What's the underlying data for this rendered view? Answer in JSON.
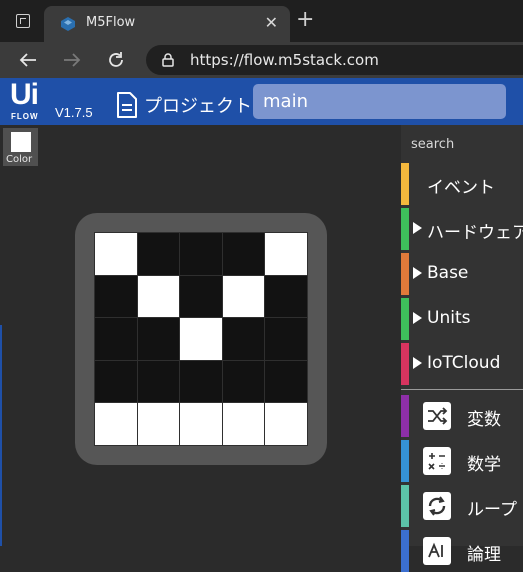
{
  "browser": {
    "tab_title": "M5Flow",
    "tab_close": "✕",
    "new_tab": "+",
    "url": "https://flow.m5stack.com"
  },
  "header": {
    "logo_top": "Ui",
    "logo_bottom": "FLOW",
    "version": "V1.7.5",
    "project_label": "プロジェクト",
    "project_name": "main"
  },
  "workspace": {
    "color_label": "Color",
    "matrix": [
      [
        1,
        0,
        0,
        0,
        1
      ],
      [
        0,
        1,
        0,
        1,
        0
      ],
      [
        0,
        0,
        1,
        0,
        0
      ],
      [
        0,
        0,
        0,
        0,
        0
      ],
      [
        1,
        1,
        1,
        1,
        1
      ]
    ],
    "on_color": "#ffffff",
    "off_color": "#121212"
  },
  "sidebar": {
    "search_placeholder": "search",
    "categories": [
      {
        "label": "イベント",
        "color": "#f4b83d",
        "arrow": false
      },
      {
        "label": "ハードウェア",
        "color": "#3ebf5b",
        "arrow": true
      },
      {
        "label": "Base",
        "color": "#e07a3a",
        "arrow": true
      },
      {
        "label": "Units",
        "color": "#3ebf5b",
        "arrow": true
      },
      {
        "label": "IoTCloud",
        "color": "#d8345f",
        "arrow": true
      }
    ],
    "tools": [
      {
        "label": "変数",
        "color": "#8e2fa8",
        "icon": "shuffle-icon"
      },
      {
        "label": "数学",
        "color": "#3592d6",
        "icon": "math-operators-icon"
      },
      {
        "label": "ループ",
        "color": "#5cc3a8",
        "icon": "loop-icon"
      },
      {
        "label": "論理",
        "color": "#3b6fd0",
        "icon": "logic-icon"
      }
    ]
  }
}
